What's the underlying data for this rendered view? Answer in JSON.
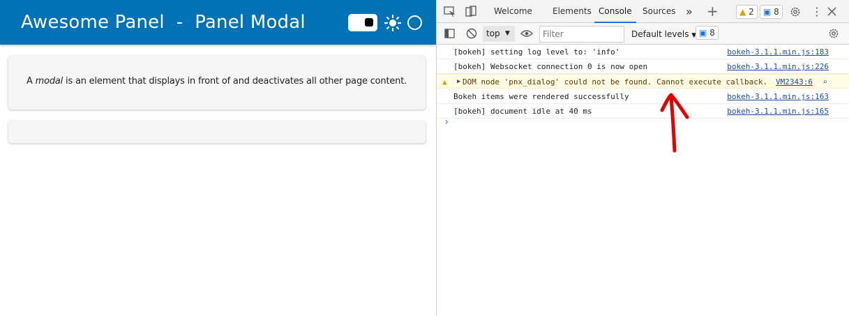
{
  "app": {
    "title": "Awesome Panel  -  Panel Modal",
    "card_text_prefix": "A ",
    "card_text_em": "modal",
    "card_text_suffix": " is an element that displays in front of and deactivates all other page content."
  },
  "devtools": {
    "tabs": [
      "Welcome",
      "Elements",
      "Console",
      "Sources"
    ],
    "active_tab": "Console",
    "warnings_count": "2",
    "messages_count": "8",
    "context": "top",
    "filter_placeholder": "Filter",
    "levels": "Default levels",
    "toolbar_messages_count": "8",
    "log": [
      {
        "message": "[bokeh] setting log level to: 'info'",
        "source": "bokeh-3.1.1.min.js:183",
        "level": "info"
      },
      {
        "message": "[bokeh] Websocket connection 0 is now open",
        "source": "bokeh-3.1.1.min.js:226",
        "level": "info"
      },
      {
        "message": "DOM node 'pnx_dialog' could not be found. Cannot execute callback.",
        "source": "VM2343:6",
        "level": "warning"
      },
      {
        "message": "Bokeh items were rendered successfully",
        "source": "bokeh-3.1.1.min.js:163",
        "level": "info"
      },
      {
        "message": "[bokeh] document idle at 40 ms",
        "source": "bokeh-3.1.1.min.js:165",
        "level": "info"
      }
    ],
    "prompt_glyph": "›"
  },
  "colors": {
    "header": "#0072b5",
    "warning_bg": "#fffbe5",
    "link": "#1a4da0",
    "annotation": "#e00000"
  }
}
